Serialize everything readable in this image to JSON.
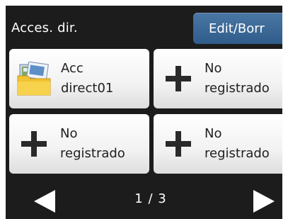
{
  "header": {
    "title": "Acces. dir.",
    "edit_button_label": "Edit/Borr"
  },
  "shortcuts": [
    {
      "label": "Acc\ndirect01",
      "icon": "folder-icon"
    },
    {
      "label": "No\nregistrado",
      "icon": "plus-icon"
    },
    {
      "label": "No\nregistrado",
      "icon": "plus-icon"
    },
    {
      "label": "No\nregistrado",
      "icon": "plus-icon"
    }
  ],
  "footer": {
    "page_indicator": "1 / 3",
    "prev_icon": "left-arrow-icon",
    "next_icon": "right-arrow-icon"
  },
  "colors": {
    "background": "#1c1c1c",
    "accent_button": "#3a6894",
    "tile": "#f2f2f2",
    "text_dark": "#202020",
    "text_light": "#ffffff"
  }
}
